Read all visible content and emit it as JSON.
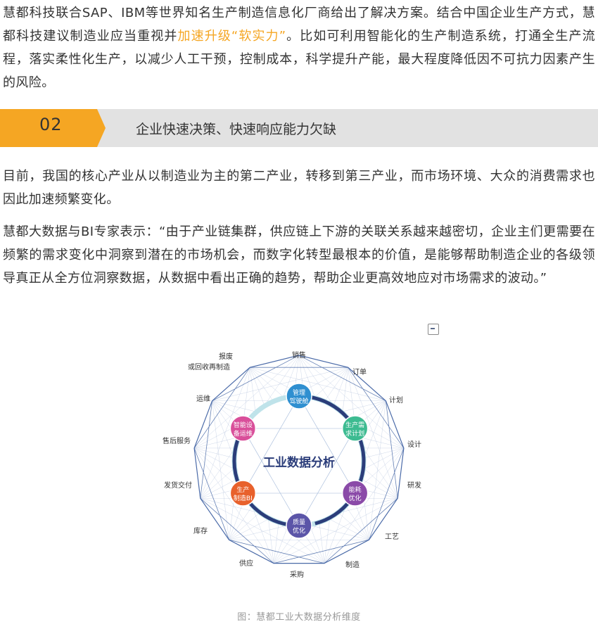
{
  "paragraph1": {
    "part1": "慧都科技联合SAP、IBM等世界知名生产制造信息化厂商给出了解决方案。结合中国企业生产方式，慧都科技建议制造业应当重视并",
    "highlight": "加速升级“软实力”",
    "part2": "。比如可利用智能化的生产制造系统，打通全生产流程，落实柔性化生产，以减少人工干预，控制成本，科学提升产能，最大程度降低因不可抗力因素产生的风险。"
  },
  "section": {
    "number": "02",
    "title": "企业快速决策、快速响应能力欠缺"
  },
  "paragraph2": "目前，我国的核心产业从以制造业为主的第二产业，转移到第三产业，而市场环境、大众的消费需求也因此加速频繁变化。",
  "paragraph3": "慧都大数据与BI专家表示：“由于产业链集群，供应链上下游的关联关系越来越密切，企业主们更需要在频繁的需求变化中洞察到潜在的市场机会，而数字化转型最根本的价值，是能够帮助制造企业的各级领导真正从全方位洞察数据，从数据中看出正确的趋势，帮助企业更高效地应对市场需求的波动。”",
  "figure": {
    "center_title": "工业数据分析",
    "outer_labels": [
      "销售",
      "订单",
      "计划",
      "设计",
      "研发",
      "工艺",
      "制造",
      "采购",
      "供应",
      "库存",
      "发货交付",
      "售后服务",
      "运维",
      "报废",
      "或回收再制造"
    ],
    "inner_nodes": [
      {
        "line1": "管理",
        "line2": "驾驶舱",
        "color": "#2f8fd0"
      },
      {
        "line1": "生产需",
        "line2": "求计划",
        "color": "#3dbb91"
      },
      {
        "line1": "能耗",
        "line2": "优化",
        "color": "#8a4aa8"
      },
      {
        "line1": "质量",
        "line2": "优化",
        "color": "#5b55a8"
      },
      {
        "line1": "生产",
        "line2": "制造BI",
        "color": "#e8612c"
      },
      {
        "line1": "智能设",
        "line2": "备运维",
        "color": "#d94f9a"
      }
    ],
    "caption": "图：慧都工业大数据分析维度"
  }
}
